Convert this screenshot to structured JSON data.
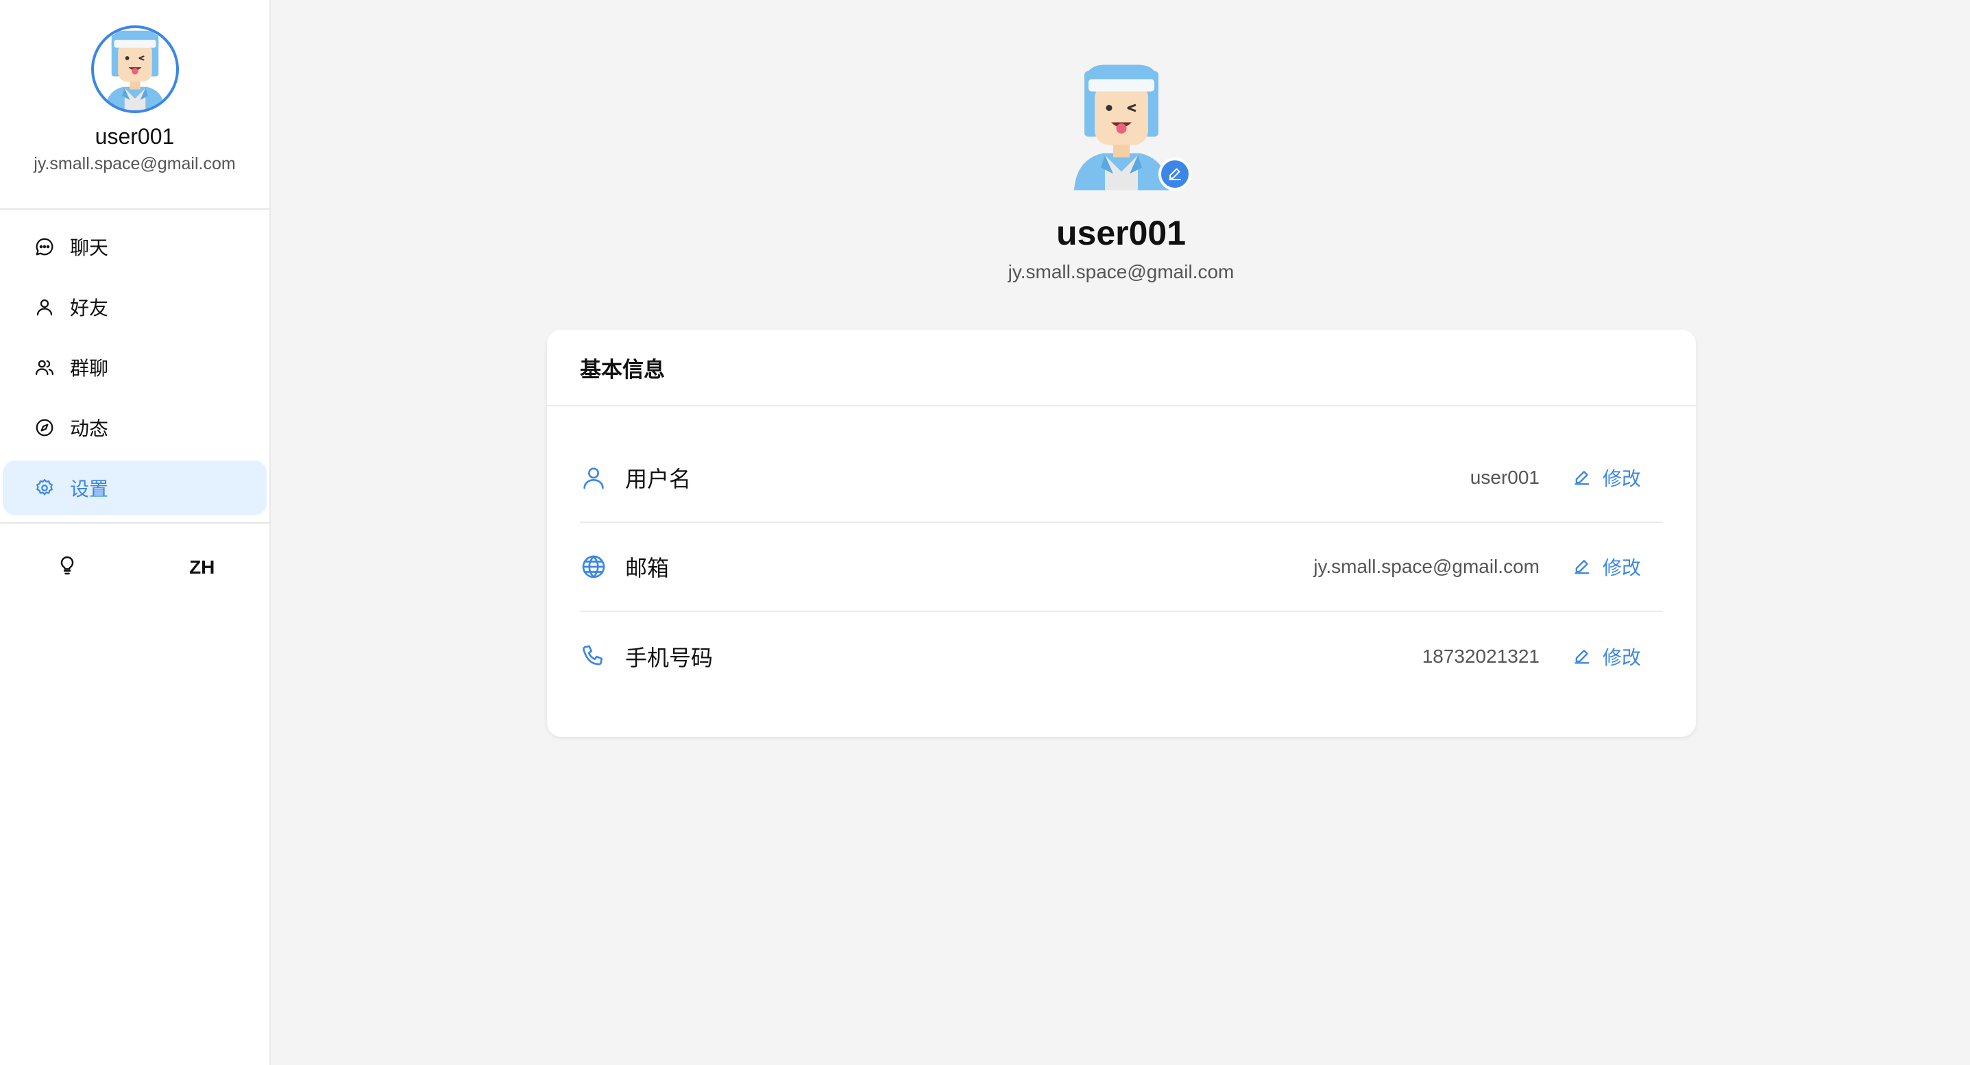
{
  "sidebar": {
    "user": {
      "name": "user001",
      "email": "jy.small.space@gmail.com"
    },
    "nav": [
      {
        "label": "聊天",
        "icon": "chat-bubble-icon"
      },
      {
        "label": "好友",
        "icon": "user-icon"
      },
      {
        "label": "群聊",
        "icon": "users-icon"
      },
      {
        "label": "动态",
        "icon": "compass-icon"
      },
      {
        "label": "设置",
        "icon": "gear-icon",
        "active": true
      }
    ],
    "tools": {
      "theme_icon": "lightbulb-icon",
      "language": "ZH"
    }
  },
  "profile": {
    "name": "user001",
    "email": "jy.small.space@gmail.com"
  },
  "card": {
    "title": "基本信息",
    "rows": [
      {
        "icon": "user-icon",
        "label": "用户名",
        "value": "user001",
        "action": "修改"
      },
      {
        "icon": "globe-icon",
        "label": "邮箱",
        "value": "jy.small.space@gmail.com",
        "action": "修改"
      },
      {
        "icon": "phone-icon",
        "label": "手机号码",
        "value": "18732021321",
        "action": "修改"
      }
    ]
  },
  "colors": {
    "accent": "#3b86e8",
    "active_bg": "#e4f1ff",
    "page_bg": "#f4f4f4"
  }
}
